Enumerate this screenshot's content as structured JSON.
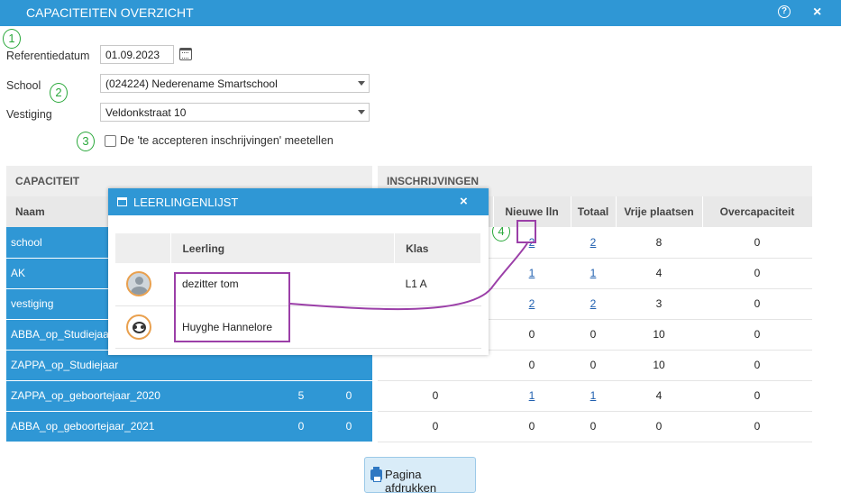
{
  "window": {
    "title": "CAPACITEITEN OVERZICHT",
    "help_glyph": "?",
    "close_glyph": "×"
  },
  "form": {
    "ref_date_label": "Referentiedatum",
    "ref_date_value": "01.09.2023",
    "school_label": "School",
    "school_value": "(024224) Nederename Smartschool",
    "vestiging_label": "Vestiging",
    "vestiging_value": "Veldonkstraat 10",
    "checkbox_label": "De 'te accepteren inschrijvingen' meetellen"
  },
  "badges": [
    "1",
    "2",
    "3",
    "4"
  ],
  "table": {
    "group_capacity": "CAPACITEIT",
    "group_enrollments": "INSCHRIJVINGEN",
    "col_naam": "Naam",
    "col_nieuwe": "Nieuwe lln",
    "col_totaal": "Totaal",
    "col_vrije": "Vrije plaatsen",
    "col_over": "Overcapaciteit",
    "rows": [
      {
        "naam": "school",
        "cap1": "",
        "cap2": "",
        "ins1": "",
        "nieuwe": "2",
        "totaal": "2",
        "vrije": "8",
        "over": "0"
      },
      {
        "naam": "AK",
        "cap1": "",
        "cap2": "",
        "ins1": "",
        "nieuwe": "1",
        "totaal": "1",
        "vrije": "4",
        "over": "0"
      },
      {
        "naam": "vestiging",
        "cap1": "",
        "cap2": "",
        "ins1": "",
        "nieuwe": "2",
        "totaal": "2",
        "vrije": "3",
        "over": "0"
      },
      {
        "naam": "ABBA_op_Studiejaar",
        "cap1": "",
        "cap2": "",
        "ins1": "",
        "nieuwe": "0",
        "totaal": "0",
        "vrije": "10",
        "over": "0"
      },
      {
        "naam": "ZAPPA_op_Studiejaar",
        "cap1": "",
        "cap2": "",
        "ins1": "",
        "nieuwe": "0",
        "totaal": "0",
        "vrije": "10",
        "over": "0"
      },
      {
        "naam": "ZAPPA_op_geboortejaar_2020",
        "cap1": "5",
        "cap2": "0",
        "ins1": "0",
        "nieuwe": "1",
        "totaal": "1",
        "vrije": "4",
        "over": "0"
      },
      {
        "naam": "ABBA_op_geboortejaar_2021",
        "cap1": "0",
        "cap2": "0",
        "ins1": "0",
        "nieuwe": "0",
        "totaal": "0",
        "vrije": "0",
        "over": "0"
      }
    ]
  },
  "popup": {
    "title": "LEERLINGENLIJST",
    "close_glyph": "×",
    "col_leerling": "Leerling",
    "col_klas": "Klas",
    "students": [
      {
        "name": "dezitter tom",
        "klas": "L1 A",
        "avatar": "default-avatar-icon"
      },
      {
        "name": "Huyghe Hannelore",
        "klas": "",
        "avatar": "panda-avatar-icon"
      }
    ]
  },
  "print_button": {
    "label": "Pagina afdrukken",
    "icon": "printer-icon"
  },
  "colors": {
    "accent": "#2f97d5",
    "annotation_green": "#29a83a",
    "annotation_purple": "#9b3fa8"
  }
}
